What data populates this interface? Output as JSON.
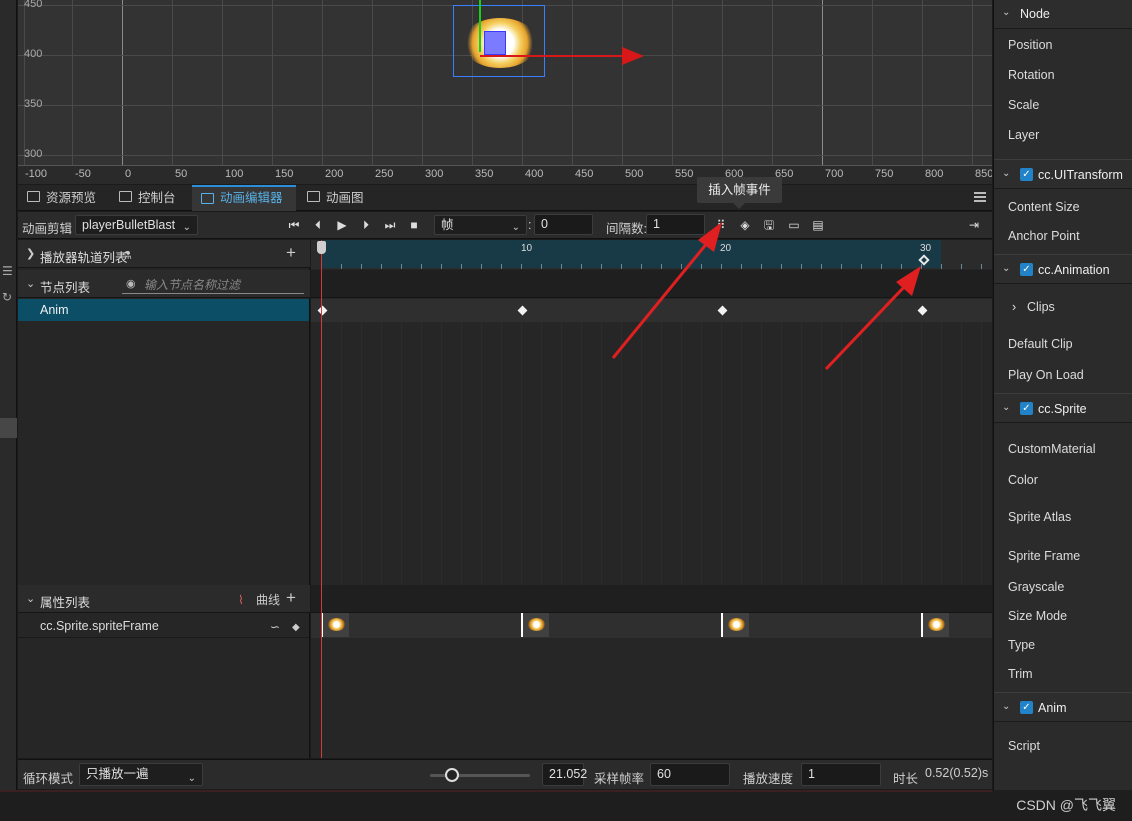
{
  "scene": {
    "y_labels": [
      "450",
      "400",
      "350",
      "300"
    ],
    "x_labels": [
      "-100",
      "-50",
      "0",
      "50",
      "100",
      "150",
      "200",
      "250",
      "300",
      "350",
      "400",
      "450",
      "500",
      "550",
      "600",
      "650",
      "700",
      "750",
      "800",
      "850"
    ]
  },
  "tabs": [
    {
      "label": "资源预览",
      "icon": "folder-icon"
    },
    {
      "label": "控制台",
      "icon": "console-icon"
    },
    {
      "label": "动画编辑器",
      "icon": "running-man-icon"
    },
    {
      "label": "动画图",
      "icon": "graph-icon"
    }
  ],
  "toolbar": {
    "clip_label": "动画剪辑",
    "clip_value": "playerBulletBlast",
    "unit_value": "帧",
    "frame_value": "0",
    "interval_label": "间隔数:",
    "interval_value": "1"
  },
  "tooltip": "插入帧事件",
  "left": {
    "player_track_label": "播放器轨道列表",
    "node_list_label": "节点列表",
    "filter_placeholder": "输入节点名称过滤",
    "node_name": "Anim",
    "prop_list_label": "属性列表",
    "curve_label": "曲线",
    "prop_name": "cc.Sprite.spriteFrame"
  },
  "timeline": {
    "ticks": [
      "10",
      "20",
      "30"
    ]
  },
  "bottom": {
    "loop_label": "循环模式",
    "loop_value": "只播放一遍",
    "zoom_value": "21.052",
    "sample_label": "采样帧率",
    "sample_value": "60",
    "speed_label": "播放速度",
    "speed_value": "1",
    "duration_label": "时长",
    "duration_value": "0.52(0.52)s"
  },
  "inspector": {
    "node_header": "Node",
    "node_props": [
      "Position",
      "Rotation",
      "Scale",
      "Layer"
    ],
    "uitransform": "cc.UITransform",
    "uitransform_props": [
      "Content Size",
      "Anchor Point"
    ],
    "animation": "cc.Animation",
    "clips_label": "Clips",
    "animation_props": [
      "Default Clip",
      "Play On Load"
    ],
    "sprite": "cc.Sprite",
    "sprite_props": [
      "CustomMaterial",
      "Color",
      "Sprite Atlas",
      "Sprite Frame",
      "Grayscale",
      "Size Mode",
      "Type",
      "Trim"
    ],
    "anim": "Anim",
    "anim_props": [
      "Script"
    ]
  },
  "watermark": "CSDN @飞飞翼",
  "colors": {
    "accent": "#2c8ed6",
    "selected_row": "#0b4e66",
    "annotation_arrow": "#e02020",
    "playhead": "#d03c3c"
  }
}
